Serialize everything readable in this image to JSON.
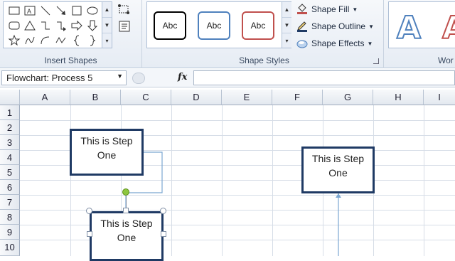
{
  "ribbon": {
    "insert_shapes": {
      "label": "Insert Shapes"
    },
    "shape_styles": {
      "label": "Shape Styles",
      "samples": [
        {
          "text": "Abc",
          "border": "#000000"
        },
        {
          "text": "Abc",
          "border": "#4f81bd"
        },
        {
          "text": "Abc",
          "border": "#c0504d"
        }
      ],
      "commands": [
        {
          "label": "Shape Fill",
          "icon": "paint-bucket-icon"
        },
        {
          "label": "Shape Outline",
          "icon": "pencil-icon"
        },
        {
          "label": "Shape Effects",
          "icon": "effects-icon"
        }
      ]
    },
    "wordart": {
      "label": "Wor",
      "samples": [
        "A",
        "A"
      ]
    }
  },
  "formula_bar": {
    "name_box": "Flowchart: Process 5",
    "fx": "fx",
    "formula": ""
  },
  "grid": {
    "columns": [
      "A",
      "B",
      "C",
      "D",
      "E",
      "F",
      "G",
      "H",
      "I"
    ],
    "rows": [
      "1",
      "2",
      "3",
      "4",
      "5",
      "6",
      "7",
      "8",
      "9",
      "10"
    ]
  },
  "shapes": [
    {
      "name": "process-1",
      "text": "This is Step One",
      "selected": false
    },
    {
      "name": "process-5",
      "text": "This is Step One",
      "selected": true
    },
    {
      "name": "process-3",
      "text": "This is Step One",
      "selected": false
    }
  ],
  "colors": {
    "shape_border": "#1f3a64",
    "connector": "#7ba7d1",
    "rotate_handle": "#8dc63f"
  }
}
